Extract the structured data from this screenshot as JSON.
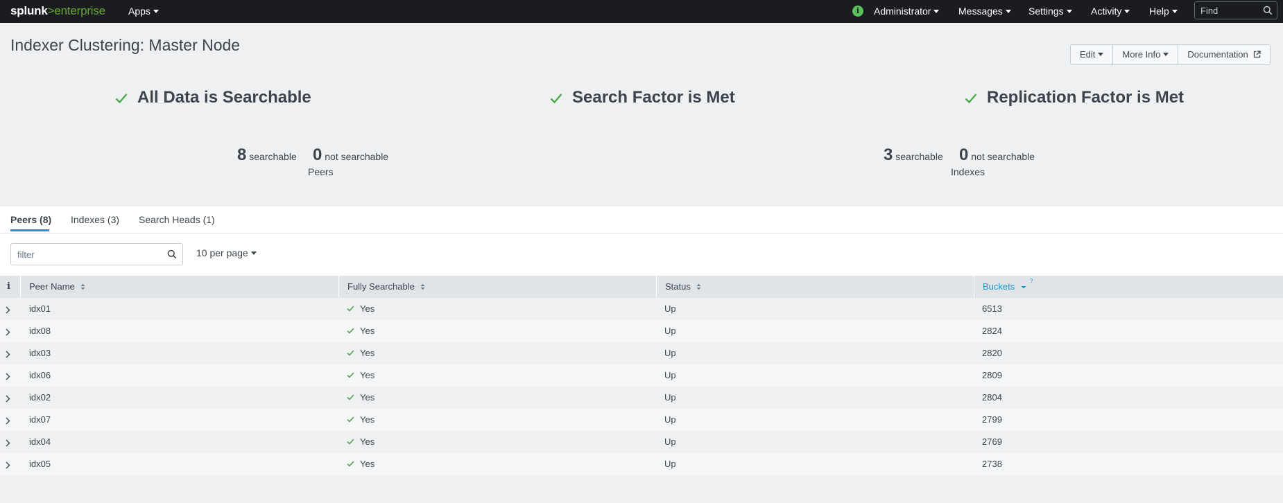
{
  "topbar": {
    "logo_brand": "splunk",
    "logo_sep": ">",
    "logo_product": "enterprise",
    "apps_label": "Apps",
    "status_glyph": "i",
    "user_label": "Administrator",
    "messages_label": "Messages",
    "settings_label": "Settings",
    "activity_label": "Activity",
    "help_label": "Help",
    "find_placeholder": "Find",
    "status_color": "#5cc05c"
  },
  "header": {
    "title": "Indexer Clustering: Master Node",
    "edit_label": "Edit",
    "more_info_label": "More Info",
    "documentation_label": "Documentation"
  },
  "status": {
    "items": [
      {
        "label": "All Data is Searchable"
      },
      {
        "label": "Search Factor is Met"
      },
      {
        "label": "Replication Factor is Met"
      }
    ],
    "check_color": "#4fa84a"
  },
  "stats": {
    "peers": {
      "searchable": "8",
      "searchable_label": "searchable",
      "not_searchable": "0",
      "not_searchable_label": "not searchable",
      "caption": "Peers"
    },
    "indexes": {
      "searchable": "3",
      "searchable_label": "searchable",
      "not_searchable": "0",
      "not_searchable_label": "not searchable",
      "caption": "Indexes"
    }
  },
  "tabs": [
    {
      "label": "Peers (8)",
      "active": true
    },
    {
      "label": "Indexes (3)",
      "active": false
    },
    {
      "label": "Search Heads (1)",
      "active": false
    }
  ],
  "filter": {
    "placeholder": "filter",
    "per_page": "10 per page"
  },
  "table": {
    "info_header": "i",
    "columns": [
      "Peer Name",
      "Fully Searchable",
      "Status",
      "Buckets"
    ],
    "rows": [
      {
        "peer": "idx01",
        "searchable": "Yes",
        "status": "Up",
        "buckets": "6513"
      },
      {
        "peer": "idx08",
        "searchable": "Yes",
        "status": "Up",
        "buckets": "2824"
      },
      {
        "peer": "idx03",
        "searchable": "Yes",
        "status": "Up",
        "buckets": "2820"
      },
      {
        "peer": "idx06",
        "searchable": "Yes",
        "status": "Up",
        "buckets": "2809"
      },
      {
        "peer": "idx02",
        "searchable": "Yes",
        "status": "Up",
        "buckets": "2804"
      },
      {
        "peer": "idx07",
        "searchable": "Yes",
        "status": "Up",
        "buckets": "2799"
      },
      {
        "peer": "idx04",
        "searchable": "Yes",
        "status": "Up",
        "buckets": "2769"
      },
      {
        "peer": "idx05",
        "searchable": "Yes",
        "status": "Up",
        "buckets": "2738"
      }
    ],
    "accent_color": "#1e93c6"
  }
}
